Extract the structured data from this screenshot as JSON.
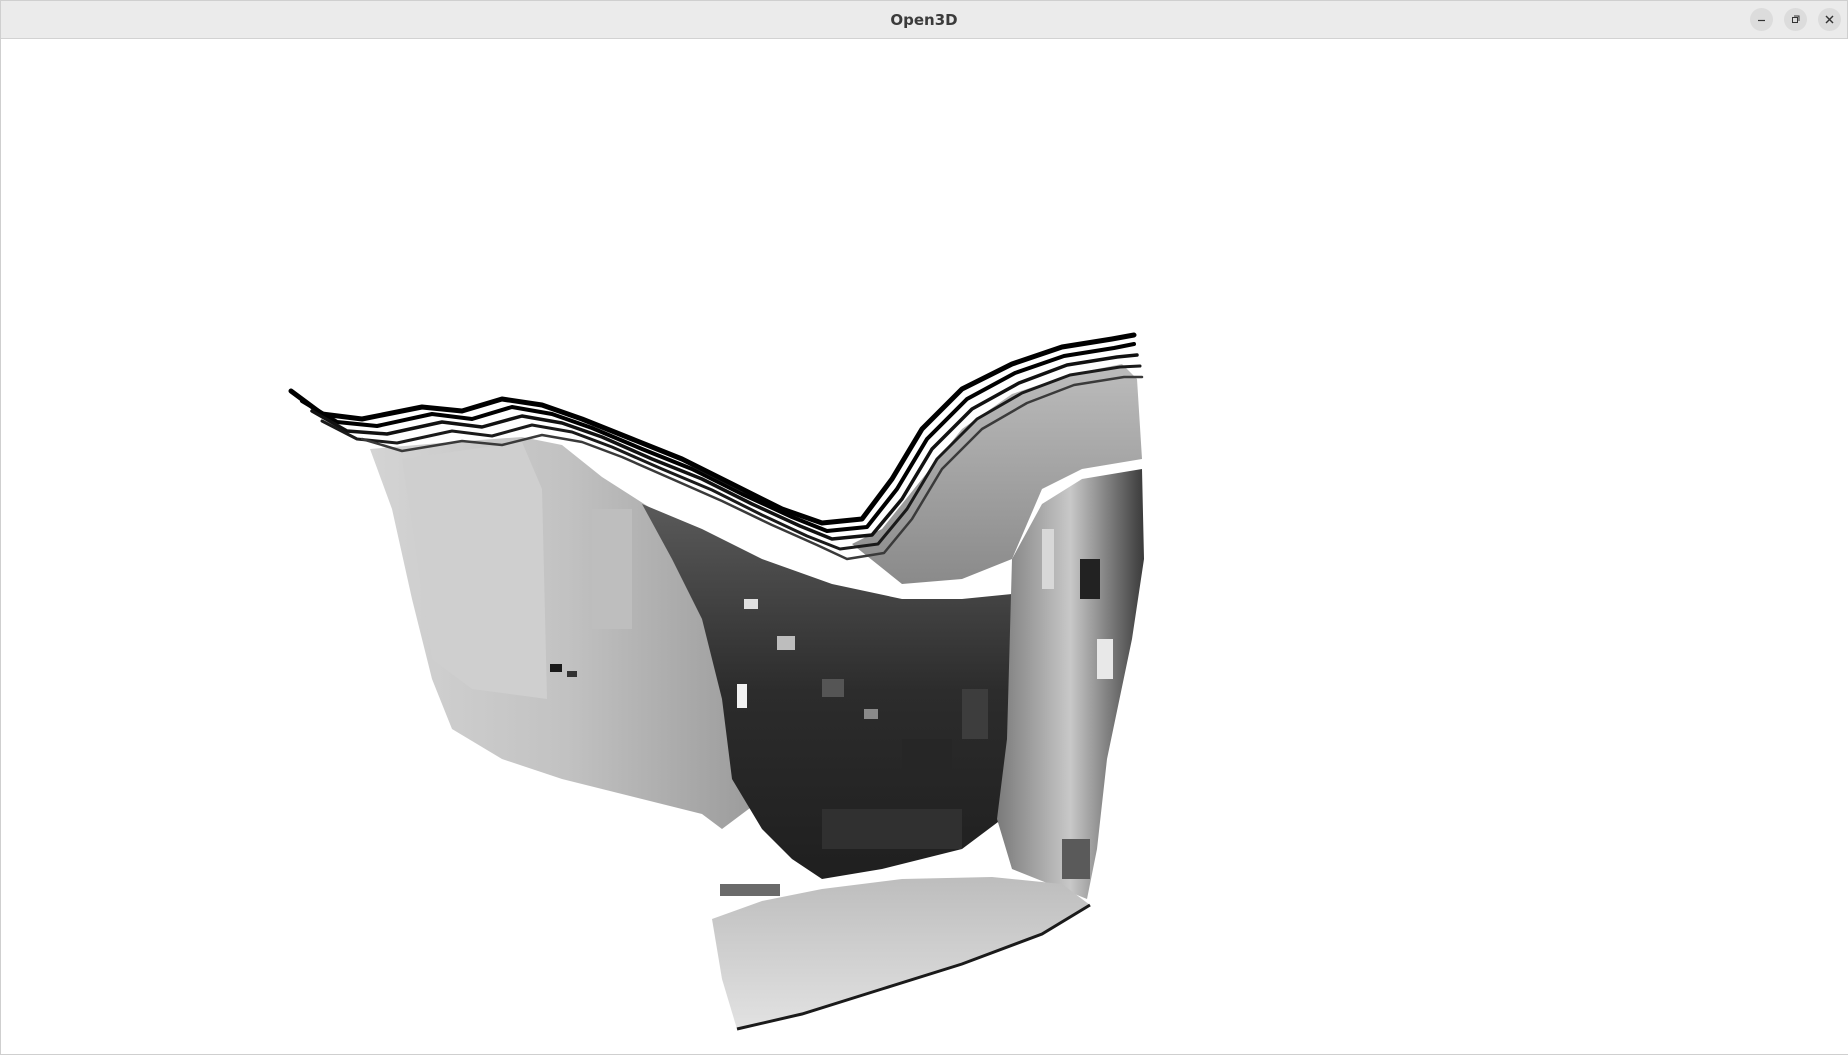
{
  "window": {
    "title": "Open3D",
    "controls": {
      "minimize_icon": "minimize-icon",
      "maximize_icon": "restore-icon",
      "close_icon": "close-icon"
    }
  },
  "viewport": {
    "content": "point-cloud-render",
    "background_color": "#ffffff",
    "point_colormap": "grayscale"
  }
}
